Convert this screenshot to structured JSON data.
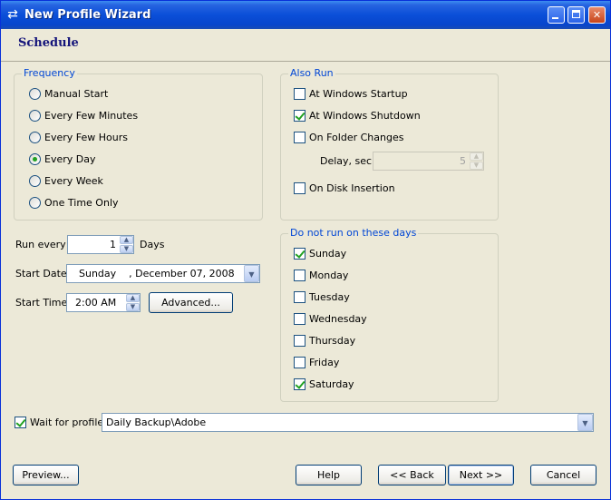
{
  "window": {
    "title": "New Profile Wizard",
    "title_icon": "arrows-exchange-icon"
  },
  "header": {
    "title": "Schedule"
  },
  "frequency": {
    "legend": "Frequency",
    "options": [
      {
        "label": "Manual Start",
        "selected": false
      },
      {
        "label": "Every Few Minutes",
        "selected": false
      },
      {
        "label": "Every Few Hours",
        "selected": false
      },
      {
        "label": "Every Day",
        "selected": true
      },
      {
        "label": "Every Week",
        "selected": false
      },
      {
        "label": "One Time Only",
        "selected": false
      }
    ]
  },
  "run_every": {
    "label": "Run every",
    "value": "1",
    "unit": "Days"
  },
  "start_date": {
    "label": "Start Date",
    "value": "Sunday    , December 07, 2008"
  },
  "start_time": {
    "label": "Start Time",
    "value": "2:00 AM",
    "advanced_label": "Advanced..."
  },
  "also_run": {
    "legend": "Also Run",
    "items": [
      {
        "label": "At Windows Startup",
        "checked": false
      },
      {
        "label": "At Windows Shutdown",
        "checked": true
      },
      {
        "label": "On Folder Changes",
        "checked": false
      },
      {
        "label": "On Disk Insertion",
        "checked": false
      }
    ],
    "delay_label": "Delay, sec",
    "delay_value": "5"
  },
  "not_run_days": {
    "legend": "Do not run on these days",
    "days": [
      {
        "label": "Sunday",
        "checked": true
      },
      {
        "label": "Monday",
        "checked": false
      },
      {
        "label": "Tuesday",
        "checked": false
      },
      {
        "label": "Wednesday",
        "checked": false
      },
      {
        "label": "Thursday",
        "checked": false
      },
      {
        "label": "Friday",
        "checked": false
      },
      {
        "label": "Saturday",
        "checked": true
      }
    ]
  },
  "wait_for_profile": {
    "label": "Wait for profile",
    "checked": true,
    "value": "Daily Backup\\Adobe"
  },
  "buttons": {
    "preview": "Preview...",
    "help": "Help",
    "back": "<< Back",
    "next": "Next >>",
    "cancel": "Cancel"
  },
  "colors": {
    "title_bar": "#0A4FD8",
    "dialog_bg": "#ECE9D8",
    "legend_text": "#0046D5",
    "check_mark": "#21A121",
    "header_text": "#14147A"
  }
}
